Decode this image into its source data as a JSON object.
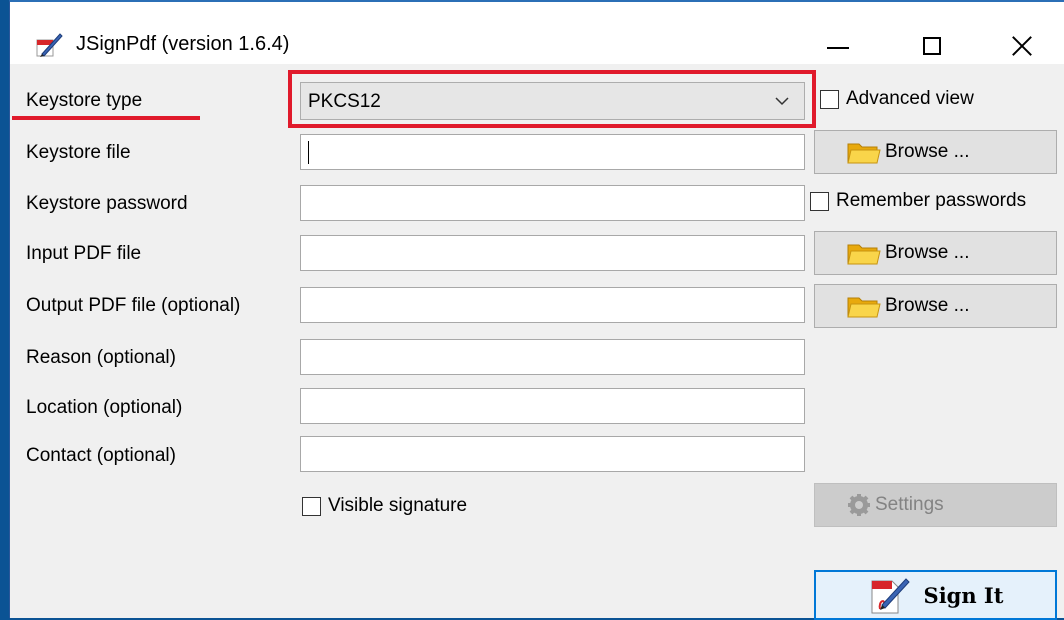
{
  "window": {
    "title": "JSignPdf (version 1.6.4)",
    "controls": [
      "minimize-icon",
      "maximize-icon",
      "close-icon"
    ]
  },
  "form": {
    "keystore_type": {
      "label": "Keystore type",
      "value": "PKCS12"
    },
    "keystore_file": {
      "label": "Keystore file",
      "value": ""
    },
    "keystore_password": {
      "label": "Keystore password",
      "value": ""
    },
    "input_pdf": {
      "label": "Input PDF file",
      "value": ""
    },
    "output_pdf": {
      "label": "Output PDF file (optional)",
      "value": ""
    },
    "reason": {
      "label": "Reason (optional)",
      "value": ""
    },
    "location": {
      "label": "Location (optional)",
      "value": ""
    },
    "contact": {
      "label": "Contact (optional)",
      "value": ""
    }
  },
  "options": {
    "advanced_view": {
      "label": "Advanced view",
      "checked": false
    },
    "remember_passwords": {
      "label": "Remember passwords",
      "checked": false
    },
    "visible_signature": {
      "label": "Visible signature",
      "checked": false
    }
  },
  "buttons": {
    "browse_label": "Browse ...",
    "settings_label": "Settings",
    "sign_label": "Sign It"
  },
  "colors": {
    "highlight": "#e01a2b",
    "sign_border": "#0078d7",
    "folder": "#f5c518"
  }
}
